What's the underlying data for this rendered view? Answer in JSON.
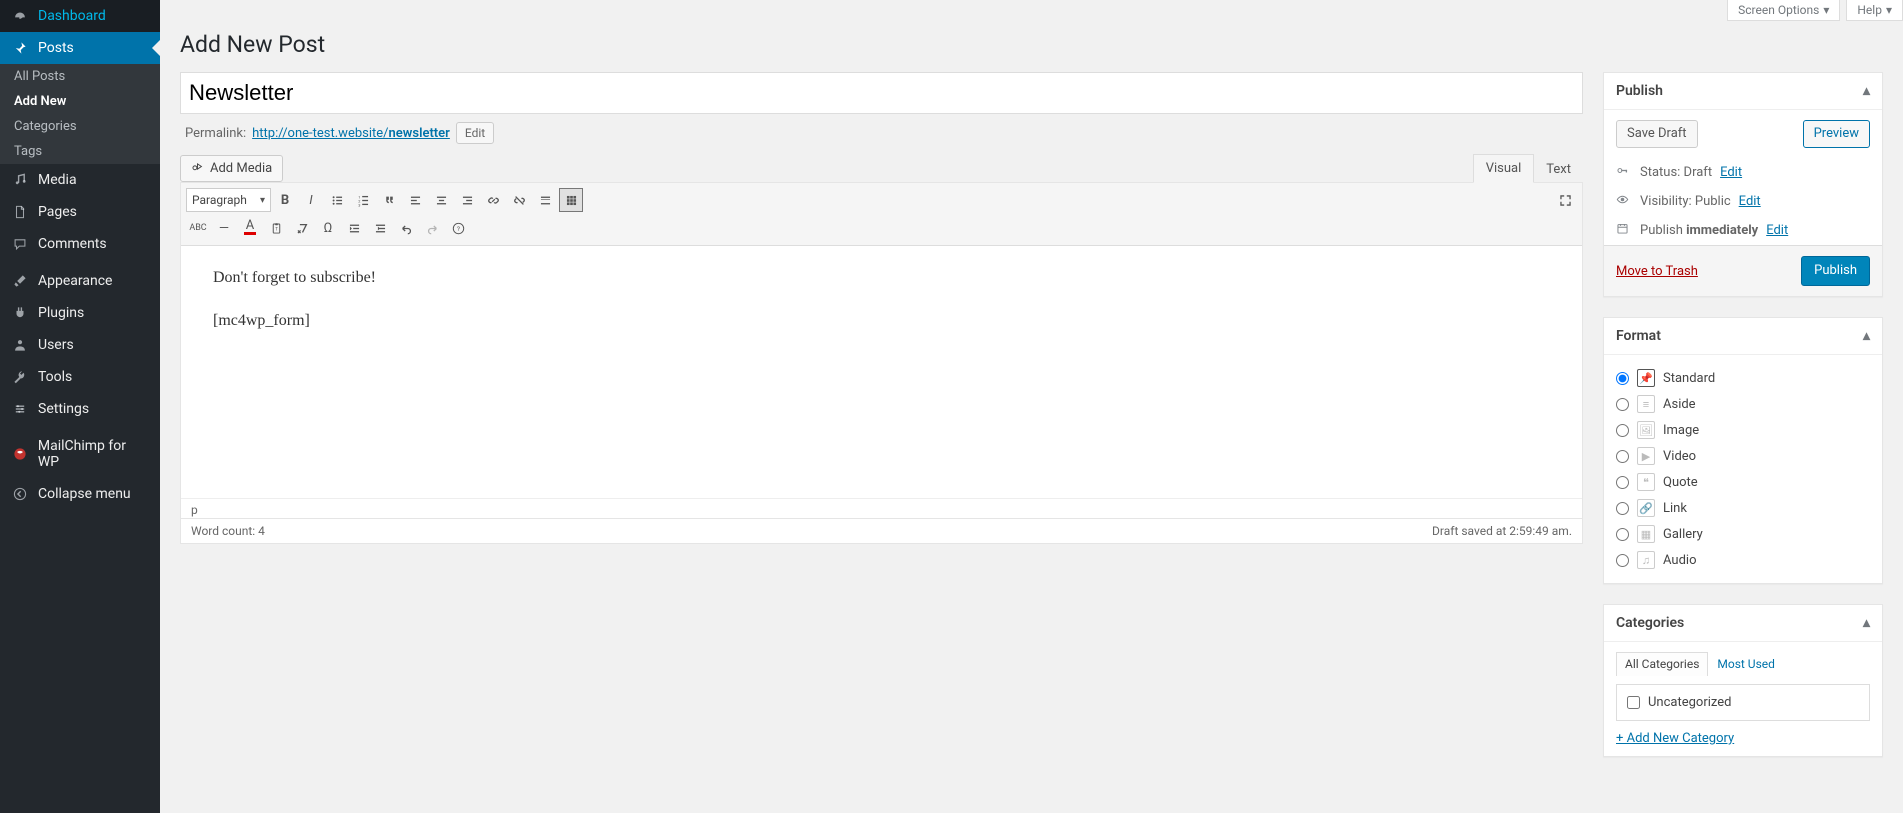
{
  "screen_meta": {
    "options": "Screen Options",
    "help": "Help"
  },
  "page_title": "Add New Post",
  "sidebar": {
    "items": [
      {
        "icon": "dash",
        "label": "Dashboard"
      },
      {
        "icon": "pin",
        "label": "Posts",
        "current": true,
        "submenu": [
          {
            "label": "All Posts"
          },
          {
            "label": "Add New",
            "current": true
          },
          {
            "label": "Categories"
          },
          {
            "label": "Tags"
          }
        ]
      },
      {
        "icon": "media",
        "label": "Media"
      },
      {
        "icon": "page",
        "label": "Pages"
      },
      {
        "icon": "comment",
        "label": "Comments"
      },
      {
        "sep": true
      },
      {
        "icon": "brush",
        "label": "Appearance"
      },
      {
        "icon": "plug",
        "label": "Plugins"
      },
      {
        "icon": "user",
        "label": "Users"
      },
      {
        "icon": "wrench",
        "label": "Tools"
      },
      {
        "icon": "gear",
        "label": "Settings"
      },
      {
        "sep": true
      },
      {
        "icon": "mc",
        "label": "MailChimp for WP"
      },
      {
        "icon": "collapse",
        "label": "Collapse menu"
      }
    ]
  },
  "title_value": "Newsletter",
  "permalink": {
    "label": "Permalink:",
    "base": "http://one-test.website/",
    "slug": "newsletter",
    "edit": "Edit"
  },
  "add_media": "Add Media",
  "editor_tabs": {
    "visual": "Visual",
    "text": "Text"
  },
  "paragraph_sel": "Paragraph",
  "content": {
    "line1": "Don't forget to subscribe!",
    "line2": "[mc4wp_form]"
  },
  "path": "p",
  "wordcount": "Word count: 4",
  "autosave": "Draft saved at 2:59:49 am.",
  "publish": {
    "heading": "Publish",
    "save_draft": "Save Draft",
    "preview": "Preview",
    "status_label": "Status: ",
    "status_value": "Draft",
    "visibility_label": "Visibility: ",
    "visibility_value": "Public",
    "schedule_label": "Publish ",
    "schedule_value": "immediately",
    "edit": "Edit",
    "trash": "Move to Trash",
    "submit": "Publish"
  },
  "format": {
    "heading": "Format",
    "options": [
      {
        "label": "Standard",
        "icon": "pin",
        "selected": true
      },
      {
        "label": "Aside",
        "icon": "aside"
      },
      {
        "label": "Image",
        "icon": "image"
      },
      {
        "label": "Video",
        "icon": "video"
      },
      {
        "label": "Quote",
        "icon": "quote"
      },
      {
        "label": "Link",
        "icon": "link"
      },
      {
        "label": "Gallery",
        "icon": "gallery"
      },
      {
        "label": "Audio",
        "icon": "audio"
      }
    ]
  },
  "categories": {
    "heading": "Categories",
    "tabs": {
      "all": "All Categories",
      "most": "Most Used"
    },
    "items": [
      {
        "label": "Uncategorized"
      }
    ],
    "add": "+ Add New Category"
  }
}
